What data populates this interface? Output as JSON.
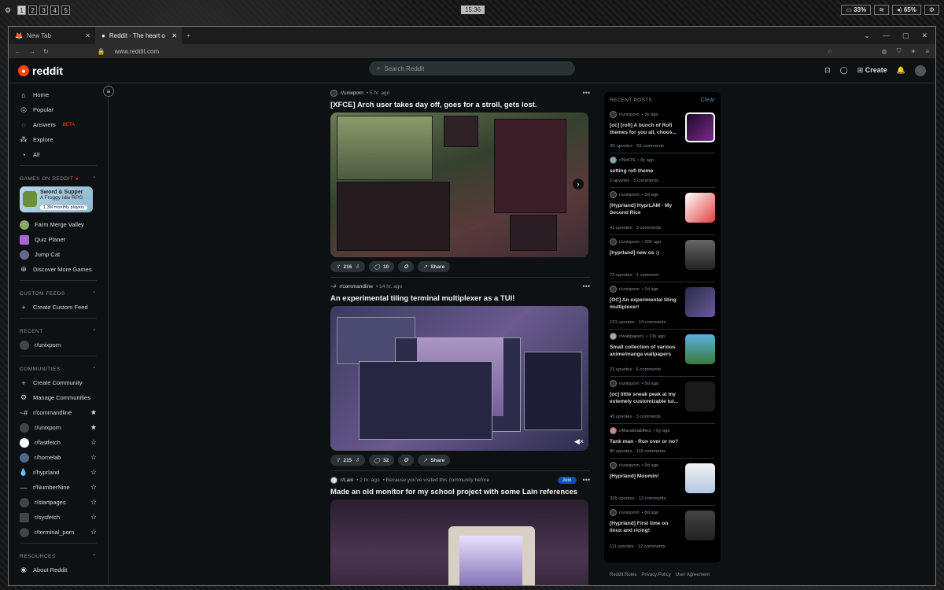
{
  "wm": {
    "workspaces": [
      "1",
      "2",
      "3",
      "4",
      "5"
    ],
    "clock": "15:36",
    "battery": "33%",
    "volume": "65%"
  },
  "tabs": [
    {
      "label": "New Tab"
    },
    {
      "label": "Reddit - The heart o"
    }
  ],
  "url": "www.reddit.com",
  "header": {
    "logo": "reddit",
    "search_placeholder": "Search Reddit",
    "create": "Create"
  },
  "sidebar": {
    "main": [
      {
        "label": "Home"
      },
      {
        "label": "Popular"
      },
      {
        "label": "Answers"
      },
      {
        "label": "Explore"
      },
      {
        "label": "All"
      }
    ],
    "beta": "BETA",
    "games_title": "GAMES ON REDDIT",
    "banner": {
      "title": "Sword & Supper",
      "subtitle": "A Froggy Idle RPG",
      "players": "1.3M monthly players"
    },
    "games": [
      {
        "label": "Farm Merge Valley"
      },
      {
        "label": "Quiz Planet"
      },
      {
        "label": "Jump Cat"
      },
      {
        "label": "Discover More Games"
      }
    ],
    "custom_title": "CUSTOM FEEDS",
    "custom_create": "Create Custom Feed",
    "recent_title": "RECENT",
    "recent": [
      {
        "label": "r/unixporn"
      }
    ],
    "communities_title": "COMMUNITIES",
    "communities": [
      {
        "label": "Create Community"
      },
      {
        "label": "Manage Communities"
      },
      {
        "label": "r/commandline"
      },
      {
        "label": "r/unixporn"
      },
      {
        "label": "r/fastfetch"
      },
      {
        "label": "r/homelab"
      },
      {
        "label": "r/hyprland"
      },
      {
        "label": "r/NumberNine"
      },
      {
        "label": "r/startpages"
      },
      {
        "label": "r/sysfetch"
      },
      {
        "label": "r/terminal_porn"
      }
    ],
    "resources_title": "RESOURCES",
    "about": "About Reddit"
  },
  "posts": [
    {
      "sub": "r/unixporn",
      "time": "• 5 hr. ago",
      "title": "[XFCE] Arch user takes day off, goes for a stroll, gets lost.",
      "votes": "216",
      "comments": "10",
      "share": "Share"
    },
    {
      "sub": "r/commandline",
      "time": "• 14 hr. ago",
      "title": "An experimental tiling terminal multiplexer as a TUI!",
      "votes": "215",
      "comments": "32",
      "share": "Share"
    },
    {
      "sub": "r/Lain",
      "time": "• 2 hr. ago",
      "reason": "• Because you've visited this community before",
      "title": "Made an old monitor for my school project with some Lain references",
      "join": "Join"
    }
  ],
  "recent_panel": {
    "title": "RECENT POSTS",
    "clear": "Clear",
    "items": [
      {
        "sub": "r/unixporn",
        "time": "• 3y ago",
        "title": "[oc] [rofi] A bunch of Rofi themes for you all, choos...",
        "stats": "2K upvotes  ·  59 comments"
      },
      {
        "sub": "r/NixOS",
        "time": "• 4y ago",
        "title": "setting rofi theme",
        "stats": "2 upvotes  ·  3 comments"
      },
      {
        "sub": "r/unixporn",
        "time": "• 2d ago",
        "title": "[Hyprland] HyprLAM - My Second Rice",
        "stats": "41 upvotes  ·  3 comments"
      },
      {
        "sub": "r/unixporn",
        "time": "• 20h ago",
        "title": "[hyprland] new os :)",
        "stats": "73 upvotes  ·  1 comment"
      },
      {
        "sub": "r/unixporn",
        "time": "• 1d ago",
        "title": "[OC] An experimental tiling multiplexer!",
        "stats": "191 upvotes  ·  14 comments"
      },
      {
        "sub": "r/wallpapers",
        "time": "• 13y ago",
        "title": "Small collection of various anime/manga wallpapers",
        "stats": "23 upvotes  ·  6 comments"
      },
      {
        "sub": "r/unixporn",
        "time": "• 5d ago",
        "title": "[oc] little sneak peak at my extemely customizable tui...",
        "stats": "45 upvotes  ·  3 comments"
      },
      {
        "sub": "r/MandelaEffect",
        "time": "• 6y ago",
        "title": "Tank man - Run over or no?",
        "stats": "80 upvotes  ·  116 comments"
      },
      {
        "sub": "r/unixporn",
        "time": "• 9d ago",
        "title": "[Hyprland] Moomin!",
        "stats": "335 upvotes  ·  12 comments"
      },
      {
        "sub": "r/unixporn",
        "time": "• 8d ago",
        "title": "[Hyprland] First time on linux and ricing!",
        "stats": "111 upvotes  ·  12 comments"
      }
    ]
  },
  "footer": [
    "Reddit Rules",
    "Privacy Policy",
    "User Agreement"
  ]
}
